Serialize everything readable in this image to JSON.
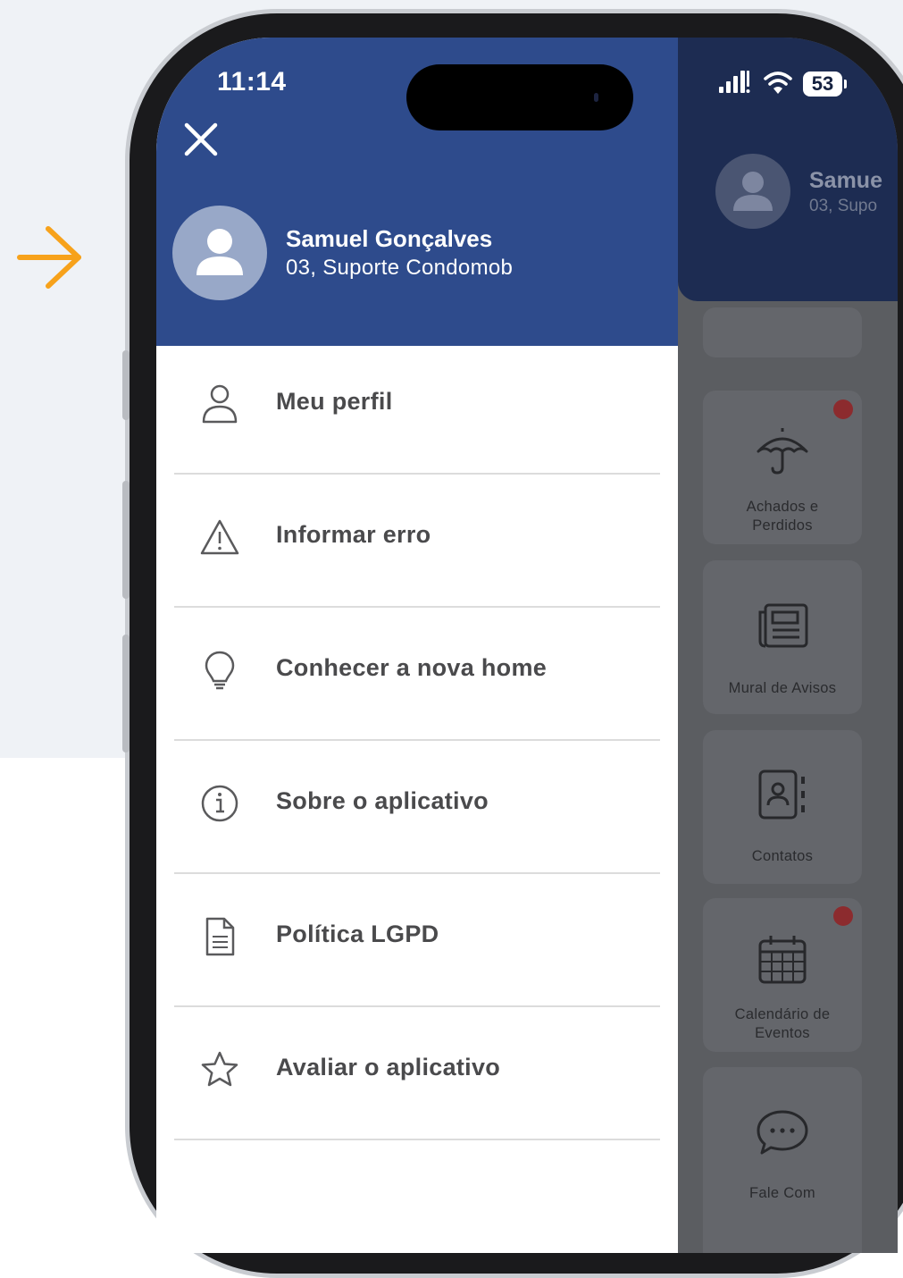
{
  "status_bar": {
    "time": "11:14",
    "battery": "53"
  },
  "drawer": {
    "close_icon": "close-icon",
    "user": {
      "name": "Samuel Gonçalves",
      "subtitle": "03, Suporte Condomob"
    },
    "menu_items": [
      {
        "label": "Meu perfil",
        "icon": "person-icon"
      },
      {
        "label": "Informar erro",
        "icon": "warning-icon"
      },
      {
        "label": "Conhecer a nova home",
        "icon": "lightbulb-icon"
      },
      {
        "label": "Sobre o aplicativo",
        "icon": "info-icon"
      },
      {
        "label": "Política LGPD",
        "icon": "document-icon"
      },
      {
        "label": "Avaliar o aplicativo",
        "icon": "star-icon"
      }
    ]
  },
  "background_app": {
    "user_name": "Samue",
    "user_subtitle": "03, Supo",
    "cards": [
      {
        "label": "Achados e\nPerdidos",
        "icon": "umbrella-icon",
        "notification": true
      },
      {
        "label": "Mural de Avisos",
        "icon": "newspaper-icon",
        "notification": false
      },
      {
        "label": "Contatos",
        "icon": "contacts-icon",
        "notification": false
      },
      {
        "label": "Calendário de\nEventos",
        "icon": "calendar-icon",
        "notification": true
      },
      {
        "label": "Fale Com",
        "icon": "chat-icon",
        "notification": false
      }
    ]
  },
  "colors": {
    "header_blue": "#2e4b8c",
    "accent_orange": "#f7a21b",
    "notification_red": "#8c2b2e"
  }
}
